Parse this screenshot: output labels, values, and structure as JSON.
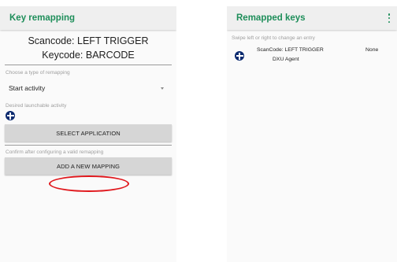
{
  "left_screen": {
    "title": "Key remapping",
    "scancode_line": "Scancode: LEFT TRIGGER",
    "keycode_line": "Keycode: BARCODE",
    "remap_type_caption": "Choose a type of remapping",
    "remap_type_value": "Start activity",
    "activity_caption": "Desired launchable activity",
    "activity_icon": "blue-cross-circle-icon",
    "select_app_label": "SELECT APPLICATION",
    "confirm_caption": "Confirm after configuring a valid remapping",
    "add_mapping_label": "ADD A NEW MAPPING"
  },
  "right_screen": {
    "title": "Remapped keys",
    "hint": "Swipe left or right to change an entry",
    "entries": [
      {
        "icon": "blue-cross-circle-icon",
        "scancode": "ScanCode: LEFT TRIGGER",
        "target": "DXU Agent",
        "value": "None"
      }
    ]
  },
  "colors": {
    "title_green": "#1e8e5a",
    "highlight_red": "#e0161b",
    "icon_blue": "#0b2a6f"
  }
}
